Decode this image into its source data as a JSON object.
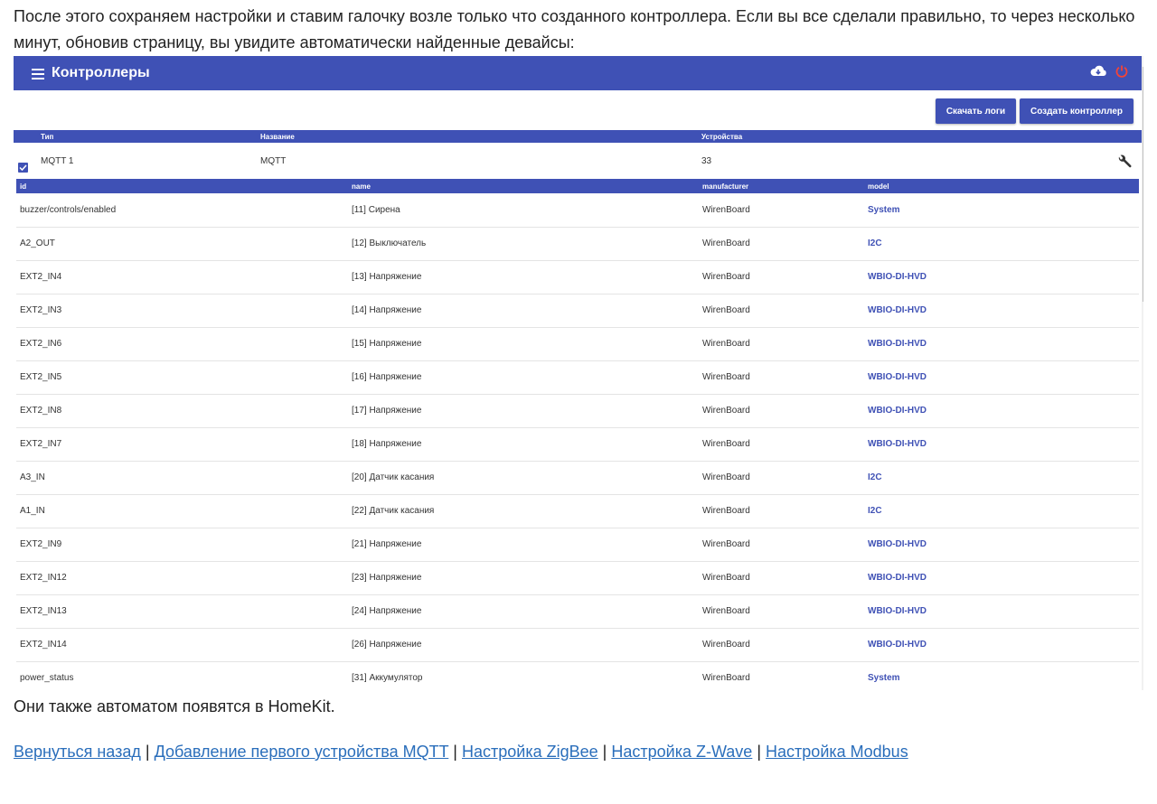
{
  "article": {
    "intro": "После этого сохраняем настройки и ставим галочку возле только что созданного контроллера. Если вы все сделали правильно, то через несколько минут, обновив страницу, вы увидите автоматически найденные девайсы:",
    "outro": "Они также автоматом появятся в HomeKit.",
    "links": [
      "Вернуться назад",
      "Добавление первого устройства MQTT",
      "Настройка ZigBee",
      "Настройка Z-Wave",
      "Настройка Modbus"
    ],
    "separator": "|"
  },
  "app": {
    "title": "Контроллеры",
    "accent_color": "#3f51b5",
    "power_color": "#f44336",
    "icons": [
      "menu-icon",
      "cloud-download-icon",
      "power-icon",
      "wrench-icon",
      "checkbox-checked-icon"
    ]
  },
  "toolbar": {
    "download_logs": "Скачать логи",
    "create_controller": "Создать контроллер"
  },
  "controllers": {
    "headers": [
      "Тип",
      "Название",
      "Устройства"
    ],
    "rows": [
      {
        "checked": true,
        "type": "MQTT 1",
        "name": "MQTT",
        "devices": "33"
      }
    ]
  },
  "devices": {
    "headers": [
      "id",
      "name",
      "manufacturer",
      "model"
    ],
    "rows": [
      {
        "id": "buzzer/controls/enabled",
        "name": "[11] Сирена",
        "manufacturer": "WirenBoard",
        "model": "System"
      },
      {
        "id": "A2_OUT",
        "name": "[12] Выключатель",
        "manufacturer": "WirenBoard",
        "model": "I2C"
      },
      {
        "id": "EXT2_IN4",
        "name": "[13] Напряжение",
        "manufacturer": "WirenBoard",
        "model": "WBIO-DI-HVD"
      },
      {
        "id": "EXT2_IN3",
        "name": "[14] Напряжение",
        "manufacturer": "WirenBoard",
        "model": "WBIO-DI-HVD"
      },
      {
        "id": "EXT2_IN6",
        "name": "[15] Напряжение",
        "manufacturer": "WirenBoard",
        "model": "WBIO-DI-HVD"
      },
      {
        "id": "EXT2_IN5",
        "name": "[16] Напряжение",
        "manufacturer": "WirenBoard",
        "model": "WBIO-DI-HVD"
      },
      {
        "id": "EXT2_IN8",
        "name": "[17] Напряжение",
        "manufacturer": "WirenBoard",
        "model": "WBIO-DI-HVD"
      },
      {
        "id": "EXT2_IN7",
        "name": "[18] Напряжение",
        "manufacturer": "WirenBoard",
        "model": "WBIO-DI-HVD"
      },
      {
        "id": "A3_IN",
        "name": "[20] Датчик касания",
        "manufacturer": "WirenBoard",
        "model": "I2C"
      },
      {
        "id": "A1_IN",
        "name": "[22] Датчик касания",
        "manufacturer": "WirenBoard",
        "model": "I2C"
      },
      {
        "id": "EXT2_IN9",
        "name": "[21] Напряжение",
        "manufacturer": "WirenBoard",
        "model": "WBIO-DI-HVD"
      },
      {
        "id": "EXT2_IN12",
        "name": "[23] Напряжение",
        "manufacturer": "WirenBoard",
        "model": "WBIO-DI-HVD"
      },
      {
        "id": "EXT2_IN13",
        "name": "[24] Напряжение",
        "manufacturer": "WirenBoard",
        "model": "WBIO-DI-HVD"
      },
      {
        "id": "EXT2_IN14",
        "name": "[26] Напряжение",
        "manufacturer": "WirenBoard",
        "model": "WBIO-DI-HVD"
      },
      {
        "id": "power_status",
        "name": "[31] Аккумулятор",
        "manufacturer": "WirenBoard",
        "model": "System"
      }
    ]
  }
}
